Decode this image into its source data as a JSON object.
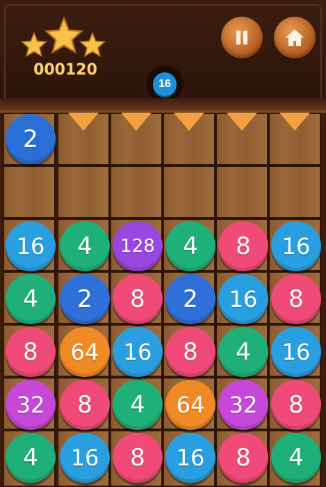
{
  "score": "000120",
  "stars": 3,
  "next_value": "16",
  "drop_ball": {
    "value": "2",
    "color": "#2a6fd6"
  },
  "colors": {
    "2": "#2f6fd8",
    "4": "#1fb07a",
    "8": "#f04a78",
    "16": "#2a9fe0",
    "32": "#c548d8",
    "64": "#f08a24",
    "128": "#9a46e0"
  },
  "grid": [
    [
      "16",
      "4",
      "128",
      "4",
      "8",
      "16"
    ],
    [
      "4",
      "2",
      "8",
      "2",
      "16",
      "8"
    ],
    [
      "8",
      "64",
      "16",
      "8",
      "4",
      "16"
    ],
    [
      "32",
      "8",
      "4",
      "64",
      "32",
      "8"
    ],
    [
      "4",
      "16",
      "8",
      "16",
      "8",
      "4"
    ]
  ],
  "buttons": {
    "pause_icon": "pause-icon",
    "home_icon": "home-icon"
  }
}
